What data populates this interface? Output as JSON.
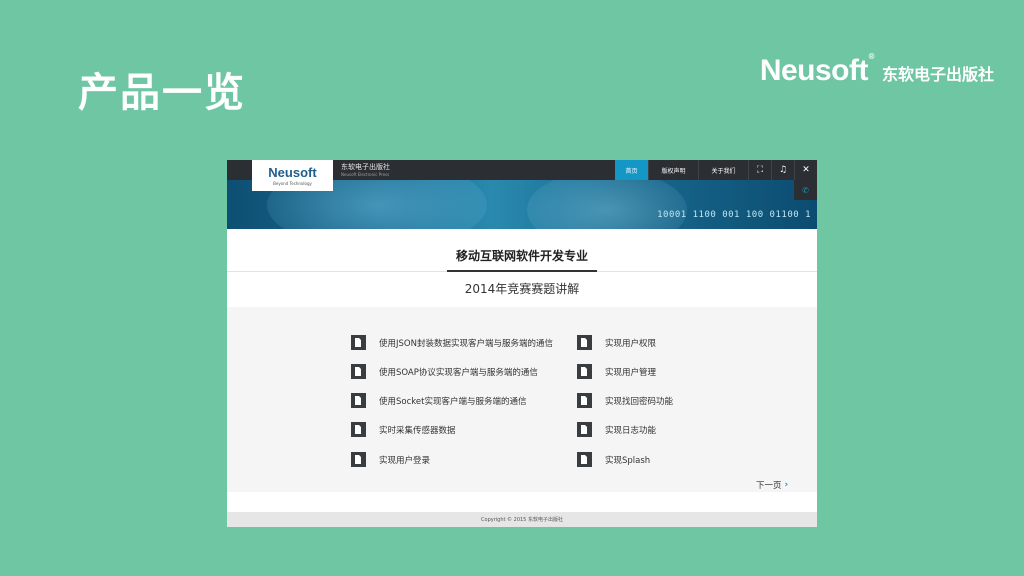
{
  "slide": {
    "title": "产品一览",
    "brand_logo": "Neusoft",
    "brand_reg": "®",
    "brand_publisher": "东软电子出版社"
  },
  "app": {
    "logo_text": "Neusoft",
    "logo_tagline": "Beyond Technology",
    "publisher_cn": "东软电子出版社",
    "publisher_en": "Neusoft Electronic Press",
    "nav": [
      {
        "label": "首页",
        "active": true
      },
      {
        "label": "版权声明"
      },
      {
        "label": "关于我们"
      }
    ],
    "icons": [
      "fullscreen-icon",
      "music-icon",
      "close-icon",
      "phone-icon"
    ],
    "icon_glyphs": {
      "fullscreen": "⛶",
      "music": "♫",
      "close": "✕",
      "phone": "✆"
    },
    "banner_binary": "10001 1100 001 100 01100 1",
    "heading": "移动互联网软件开发专业",
    "subheading": "2014年竞赛赛题讲解",
    "items_left": [
      "使用JSON封装数据实现客户端与服务端的通信",
      "使用SOAP协议实现客户端与服务端的通信",
      "使用Socket实现客户端与服务端的通信",
      "实时采集传感器数据",
      "实现用户登录"
    ],
    "items_right": [
      "实现用户权限",
      "实现用户管理",
      "实现找回密码功能",
      "实现日志功能",
      "实现Splash"
    ],
    "next_page": "下一页",
    "footer": "Copyright © 2015   东软电子出版社",
    "accent_color": "#1597c6",
    "background_color": "#6fc6a2"
  }
}
